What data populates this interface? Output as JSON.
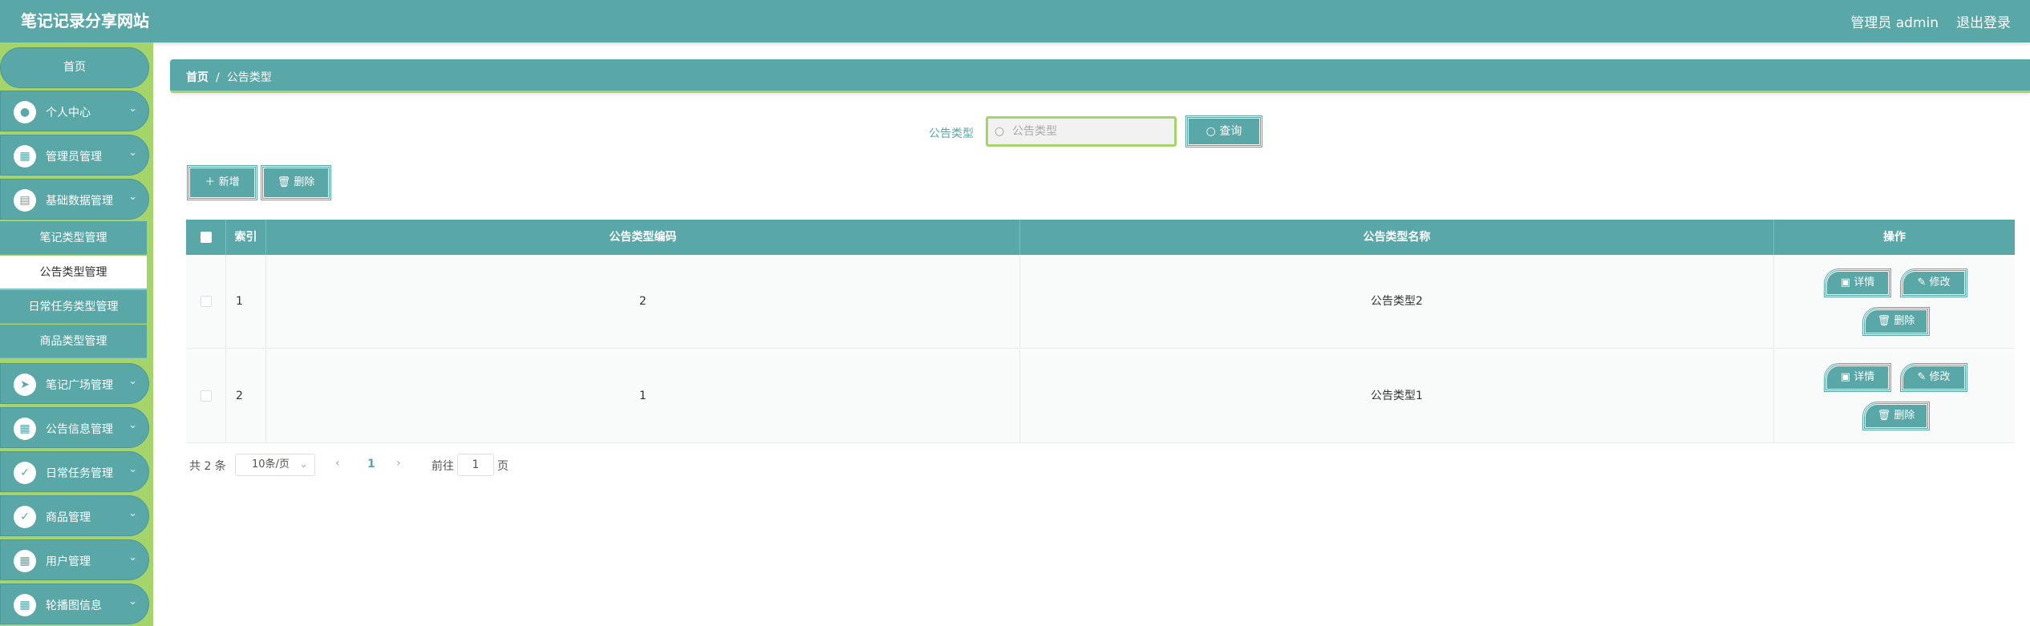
{
  "header": {
    "site_title": "笔记记录分享网站",
    "user_label": "管理员 admin",
    "logout_label": "退出登录"
  },
  "sidebar": {
    "home": "首页",
    "items": [
      {
        "label": "个人中心",
        "icon": "user-icon"
      },
      {
        "label": "管理员管理",
        "icon": "grid-icon"
      },
      {
        "label": "基础数据管理",
        "icon": "database-icon"
      },
      {
        "label": "笔记广场管理",
        "icon": "send-icon"
      },
      {
        "label": "公告信息管理",
        "icon": "grid-icon"
      },
      {
        "label": "日常任务管理",
        "icon": "clipboard-icon"
      },
      {
        "label": "商品管理",
        "icon": "clipboard-icon"
      },
      {
        "label": "用户管理",
        "icon": "grid-icon"
      },
      {
        "label": "轮播图信息",
        "icon": "grid-icon"
      }
    ],
    "sub_items": [
      "笔记类型管理",
      "公告类型管理",
      "日常任务类型管理",
      "商品类型管理"
    ]
  },
  "breadcrumb": {
    "home": "首页",
    "separator": "/",
    "current": "公告类型"
  },
  "search": {
    "label": "公告类型",
    "placeholder": "公告类型",
    "value": "",
    "button_label": "查询"
  },
  "toolbar": {
    "add_label": "新增",
    "delete_label": "删除"
  },
  "table": {
    "columns": [
      "索引",
      "公告类型编码",
      "公告类型名称",
      "操作"
    ],
    "rows": [
      {
        "index": "1",
        "code": "2",
        "name": "公告类型2"
      },
      {
        "index": "2",
        "code": "1",
        "name": "公告类型1"
      }
    ],
    "actions": {
      "detail": "详情",
      "edit": "修改",
      "delete": "删除"
    }
  },
  "pagination": {
    "total_text": "共 2 条",
    "page_size": "10条/页",
    "current_page": "1",
    "goto_label": "前往",
    "goto_value": "1",
    "page_unit": "页"
  },
  "colors": {
    "primary": "#5aa7a8",
    "accent": "#a5d46a"
  }
}
